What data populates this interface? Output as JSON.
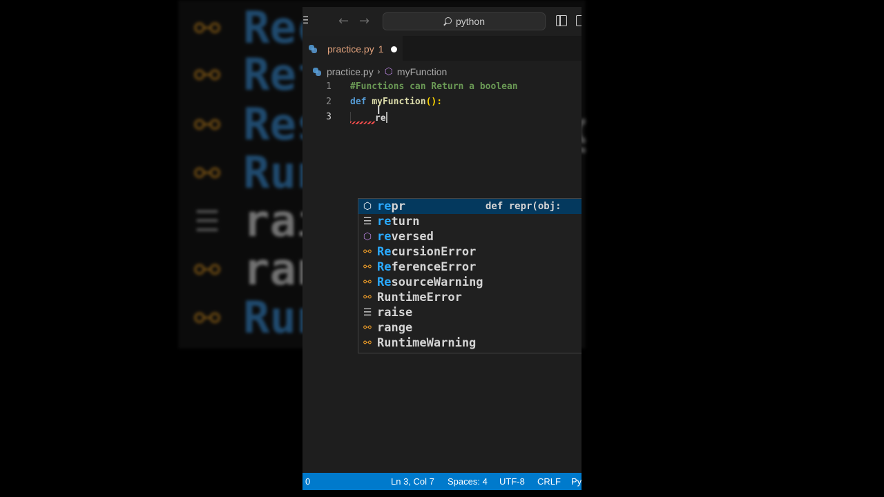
{
  "backdrop": {
    "rows": [
      {
        "icon": "class-icon",
        "text": "Rec"
      },
      {
        "icon": "class-icon",
        "text": "Ref"
      },
      {
        "icon": "class-icon",
        "text": "Res"
      },
      {
        "icon": "class-icon",
        "text": "Run"
      },
      {
        "icon": "keyword-icon",
        "text": "rai"
      },
      {
        "icon": "class-icon",
        "text": "ran"
      },
      {
        "icon": "class-icon",
        "text": "Run"
      }
    ],
    "right_fragments": [
      "g"
    ]
  },
  "titlebar": {
    "search_text": "python"
  },
  "tab": {
    "filename": "practice.py",
    "problem_count": "1"
  },
  "breadcrumb": {
    "file": "practice.py",
    "symbol": "myFunction"
  },
  "code": {
    "lines": [
      {
        "number": "1",
        "text": "#Functions can Return a boolean"
      },
      {
        "number": "2",
        "keyword": "def",
        "function": "myFunction",
        "parens": "():",
        "colon": ""
      },
      {
        "number": "3",
        "text": "re"
      }
    ]
  },
  "suggestions": {
    "detail": "def repr(obj: ",
    "items": [
      {
        "icon": "cube-icon",
        "match": "re",
        "rest": "pr",
        "selected": true
      },
      {
        "icon": "keyword-icon",
        "match": "re",
        "rest": "turn"
      },
      {
        "icon": "cube-icon",
        "match": "re",
        "rest": "versed"
      },
      {
        "icon": "class-icon",
        "match": "Re",
        "rest": "cursionError"
      },
      {
        "icon": "class-icon",
        "match": "Re",
        "rest": "ferenceError"
      },
      {
        "icon": "class-icon",
        "match": "Re",
        "rest": "sourceWarning"
      },
      {
        "icon": "class-icon",
        "label": "RuntimeError"
      },
      {
        "icon": "keyword-icon",
        "label": "raise"
      },
      {
        "icon": "class-icon",
        "label": "range"
      },
      {
        "icon": "class-icon",
        "label": "RuntimeWarning"
      }
    ]
  },
  "statusbar": {
    "left": "0",
    "position": "Ln 3, Col 7",
    "spaces": "Spaces: 4",
    "encoding": "UTF-8",
    "eol": "CRLF",
    "language": "Py"
  },
  "colors": {
    "accent": "#007acc",
    "match_highlight": "#2aaaff",
    "selection": "#04395e",
    "class_icon": "#ee9d28",
    "method_icon": "#b180d7",
    "tab_modified": "#e2a27c"
  }
}
